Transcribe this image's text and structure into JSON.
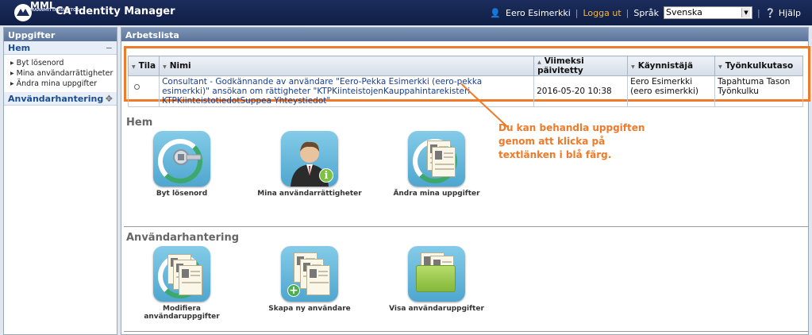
{
  "header": {
    "logo_text": "MML",
    "logo_subtext": "MAANMITTAUSLAITOS",
    "title": "CA Identity Manager",
    "user": "Eero Esimerkki",
    "logout": "Logga ut",
    "language_label": "Språk",
    "language_value": "Svenska",
    "help": "Hjälp"
  },
  "sidebar": {
    "title": "Uppgifter",
    "sections": [
      {
        "label": "Hem",
        "toggle": "−",
        "items": [
          "Byt lösenord",
          "Mina användarrättigheter",
          "Ändra mina uppgifter"
        ]
      },
      {
        "label": "Användarhantering",
        "toggle": "✥"
      }
    ]
  },
  "worklist": {
    "title": "Arbetslista",
    "columns": [
      "Tila",
      "Nimi",
      "Viimeksi päivitetty",
      "Käynnistäjä",
      "Työnkulkutaso"
    ],
    "row": {
      "name": "Consultant - Godkännande av användare \"Eero-Pekka Esimerkki (eero-pekka esimerkki)\" ansökan om rättigheter \"KTPKiinteistojenKauppahintarekisteri KTPKiinteistotiedotSuppea Yhteystiedot\"",
      "updated": "2016-05-20 10:38",
      "initiator": "Eero Esimerkki (eero esimerkki)",
      "workflow_level": "Tapahtuma Tason Työnkulku"
    }
  },
  "callout": "Du kan behandla uppgiften genom att klicka på textlänken i blå färg.",
  "sections": {
    "home": {
      "title": "Hem",
      "tiles": [
        "Byt lösenord",
        "Mina användarrättigheter",
        "Ändra mina uppgifter"
      ]
    },
    "user_mgmt": {
      "title": "Användarhantering",
      "tiles": [
        "Modifiera användaruppgifter",
        "Skapa ny användare",
        "Visa användaruppgifter"
      ]
    }
  },
  "colors": {
    "header_bg": "#1b2d5c",
    "highlight": "#ef7a2a",
    "link": "#1a3f8c"
  }
}
